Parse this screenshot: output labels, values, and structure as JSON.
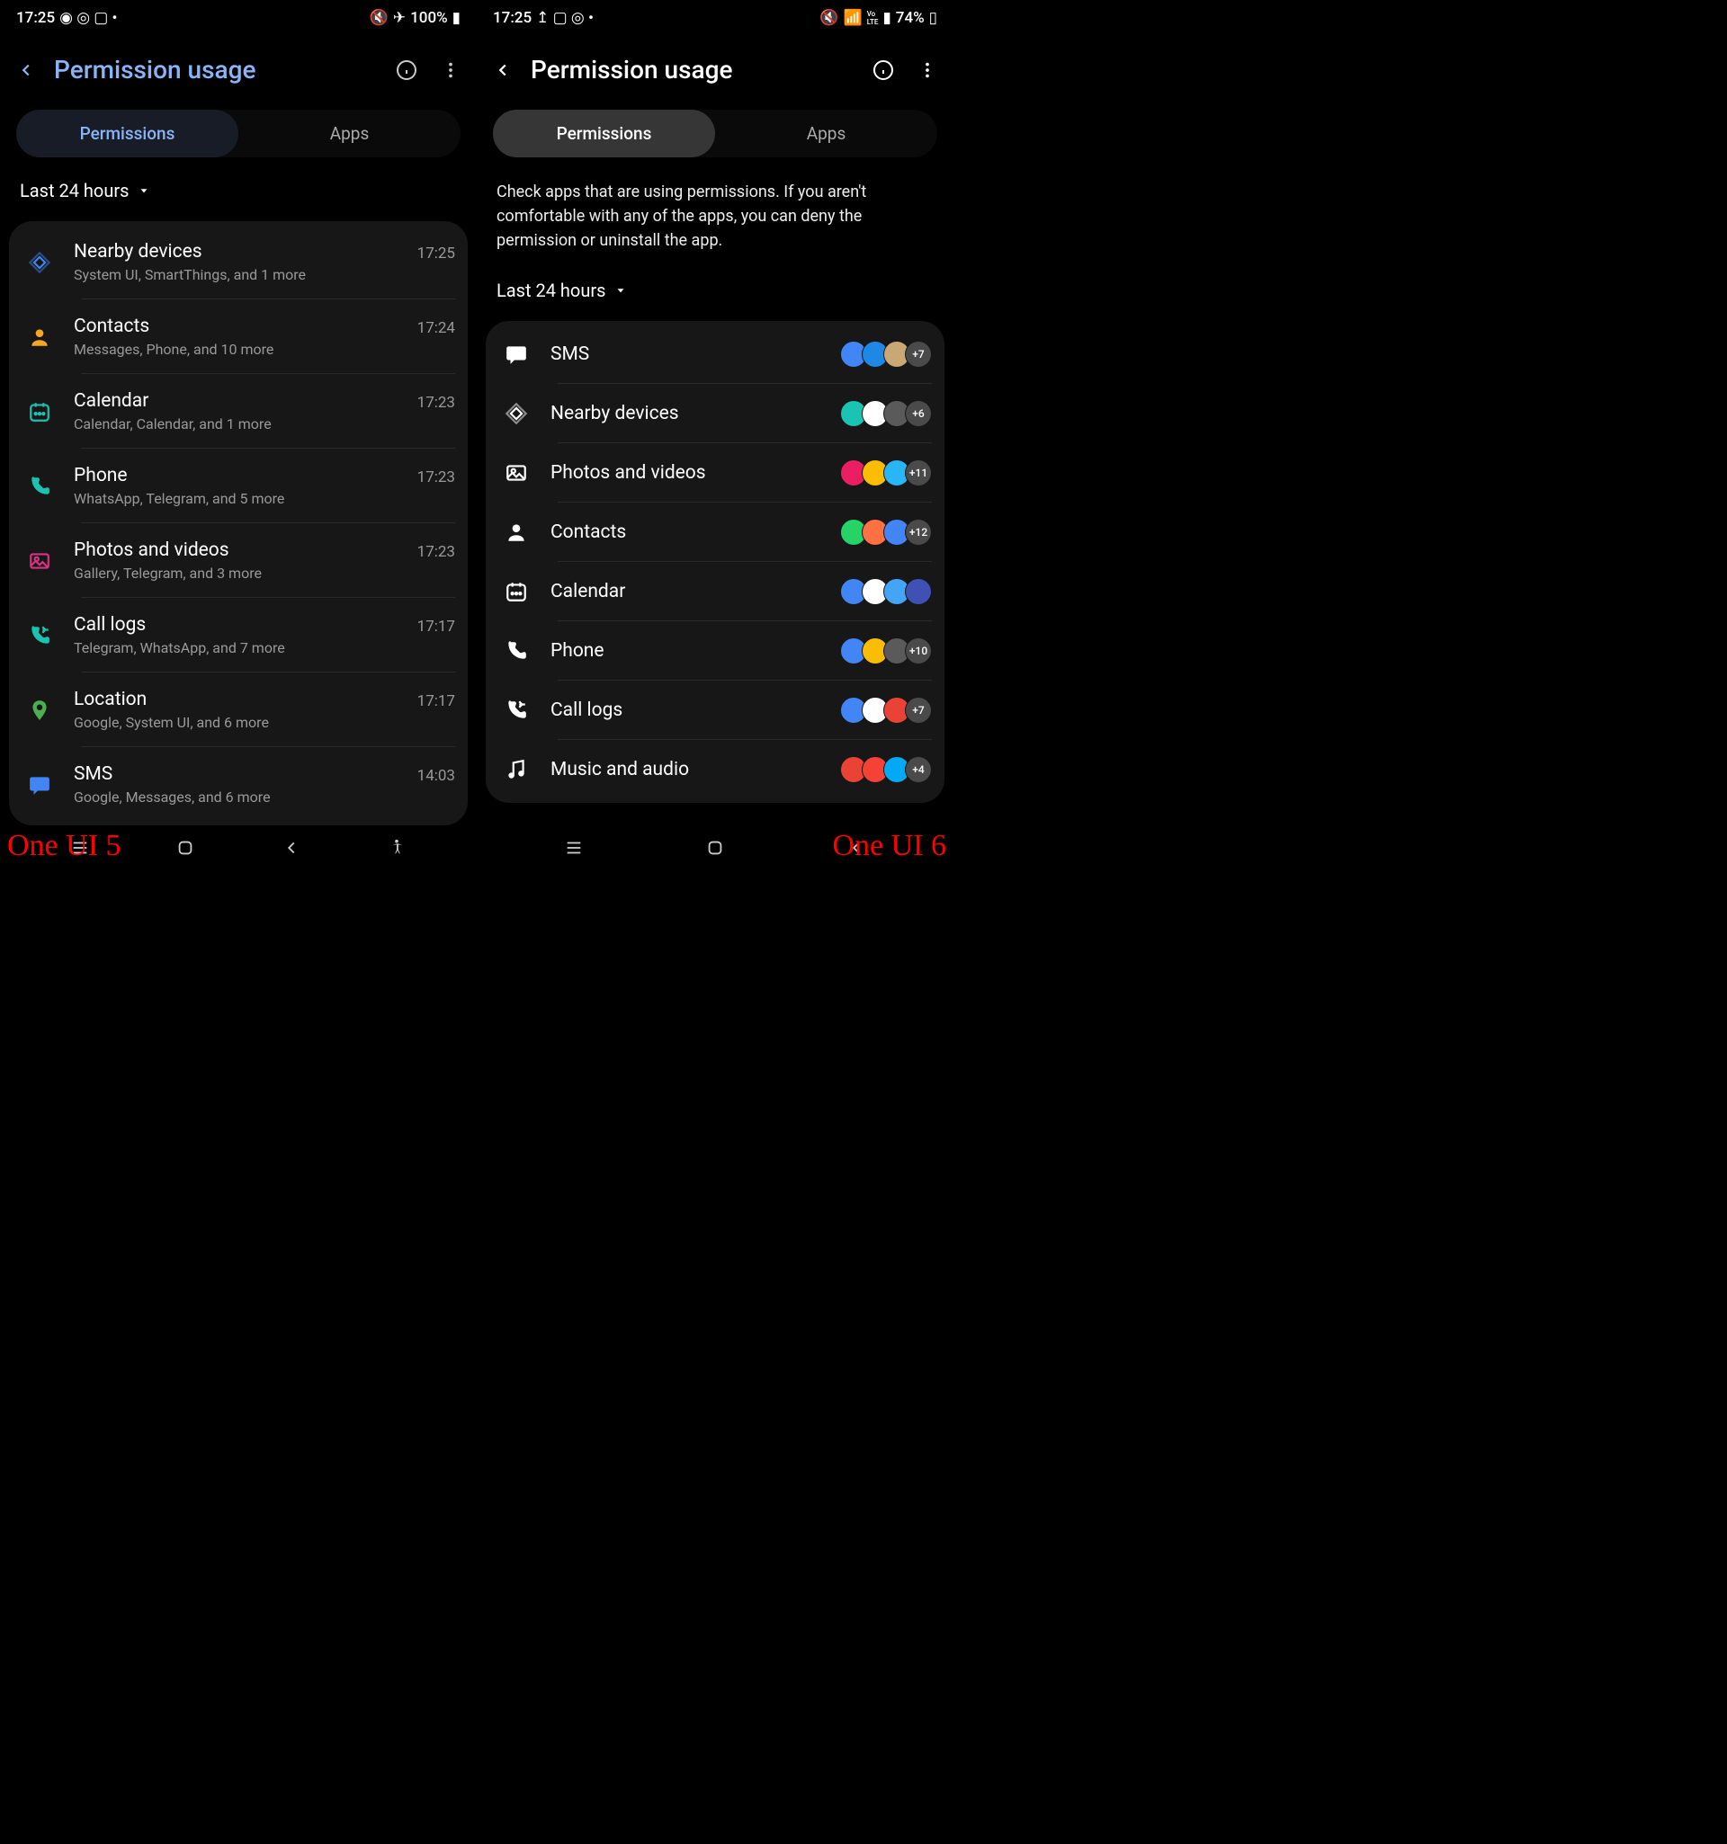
{
  "left": {
    "watermark": "One UI 5",
    "status": {
      "time": "17:25",
      "battery": "100%"
    },
    "title": "Permission usage",
    "tabs": {
      "permissions": "Permissions",
      "apps": "Apps"
    },
    "filter": "Last 24 hours",
    "items": [
      {
        "icon": "nearby",
        "color": "#4285f4",
        "name": "Nearby devices",
        "sub": "System UI, SmartThings, and 1 more",
        "time": "17:25"
      },
      {
        "icon": "contacts",
        "color": "#f5a623",
        "name": "Contacts",
        "sub": "Messages, Phone, and 10 more",
        "time": "17:24"
      },
      {
        "icon": "calendar",
        "color": "#1bc4b2",
        "name": "Calendar",
        "sub": "Calendar, Calendar, and 1 more",
        "time": "17:23"
      },
      {
        "icon": "phone",
        "color": "#1bc4b2",
        "name": "Phone",
        "sub": "WhatsApp, Telegram, and 5 more",
        "time": "17:23"
      },
      {
        "icon": "photos",
        "color": "#d63384",
        "name": "Photos and videos",
        "sub": "Gallery, Telegram, and 3 more",
        "time": "17:23"
      },
      {
        "icon": "calllog",
        "color": "#1bc4b2",
        "name": "Call logs",
        "sub": "Telegram, WhatsApp, and 7 more",
        "time": "17:17"
      },
      {
        "icon": "location",
        "color": "#4caf50",
        "name": "Location",
        "sub": "Google, System UI, and 6 more",
        "time": "17:17"
      },
      {
        "icon": "sms",
        "color": "#4285f4",
        "name": "SMS",
        "sub": "Google, Messages, and 6 more",
        "time": "14:03"
      }
    ]
  },
  "right": {
    "watermark": "One UI 6",
    "status": {
      "time": "17:25",
      "battery": "74%"
    },
    "title": "Permission usage",
    "tabs": {
      "permissions": "Permissions",
      "apps": "Apps"
    },
    "description": "Check apps that are using permissions. If you aren't comfortable with any of the apps, you can deny the permission or uninstall the app.",
    "filter": "Last 24 hours",
    "items": [
      {
        "icon": "sms",
        "name": "SMS",
        "badges": [
          "#4285f4",
          "#1e88e5",
          "#c9a876"
        ],
        "more": "+7"
      },
      {
        "icon": "nearby",
        "name": "Nearby devices",
        "badges": [
          "#1bc4b2",
          "#ffffff",
          "#5a5a5a"
        ],
        "more": "+6"
      },
      {
        "icon": "photos",
        "name": "Photos and videos",
        "badges": [
          "#e91e63",
          "#fbbc04",
          "#29b6f6"
        ],
        "more": "+11"
      },
      {
        "icon": "contacts",
        "name": "Contacts",
        "badges": [
          "#25d366",
          "#ff7043",
          "#4285f4"
        ],
        "more": "+12"
      },
      {
        "icon": "calendar",
        "name": "Calendar",
        "badges": [
          "#4285f4",
          "#ffffff",
          "#42a5f5",
          "#3f51b5"
        ],
        "more": ""
      },
      {
        "icon": "phone",
        "name": "Phone",
        "badges": [
          "#4285f4",
          "#fbbc04",
          "#5a5a5a"
        ],
        "more": "+10"
      },
      {
        "icon": "calllog",
        "name": "Call logs",
        "badges": [
          "#4285f4",
          "#ffffff",
          "#ea4335"
        ],
        "more": "+7"
      },
      {
        "icon": "music",
        "name": "Music and audio",
        "badges": [
          "#ea4335",
          "#f44336",
          "#03a9f4"
        ],
        "more": "+4"
      }
    ]
  }
}
